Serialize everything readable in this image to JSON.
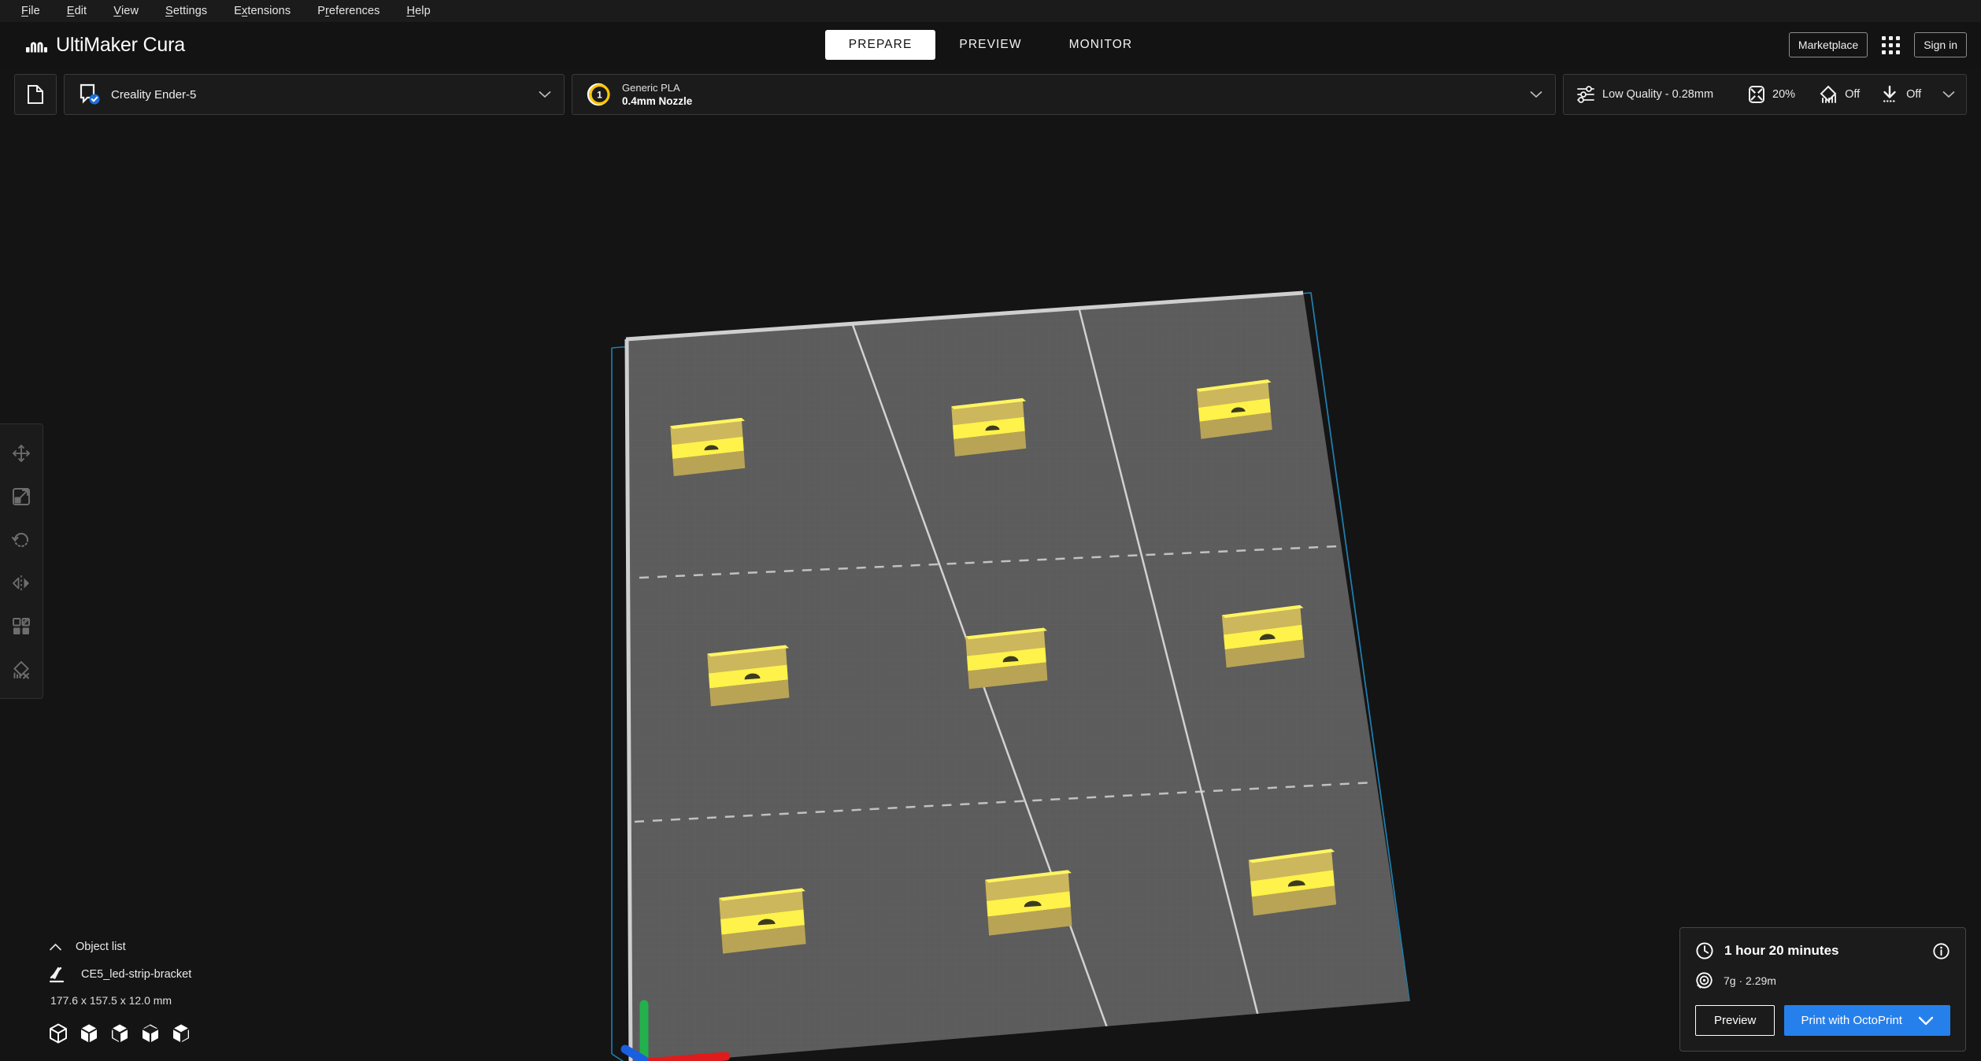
{
  "menubar": {
    "items": [
      {
        "pre": "",
        "key": "F",
        "post": "ile"
      },
      {
        "pre": "",
        "key": "E",
        "post": "dit"
      },
      {
        "pre": "",
        "key": "V",
        "post": "iew"
      },
      {
        "pre": "",
        "key": "S",
        "post": "ettings"
      },
      {
        "pre": "E",
        "key": "x",
        "post": "tensions"
      },
      {
        "pre": "P",
        "key": "r",
        "post": "eferences"
      },
      {
        "pre": "",
        "key": "H",
        "post": "elp"
      }
    ]
  },
  "app": {
    "title": "UltiMaker Cura",
    "logo_icon": "ultimaker-logo-icon"
  },
  "stages": {
    "tabs": [
      {
        "label": "PREPARE",
        "active": true
      },
      {
        "label": "PREVIEW",
        "active": false
      },
      {
        "label": "MONITOR",
        "active": false
      }
    ]
  },
  "header_right": {
    "marketplace_label": "Marketplace",
    "apps_icon": "grid-apps-icon",
    "signin_label": "Sign in"
  },
  "configbar": {
    "open_file_icon": "open-folder-icon",
    "printer": {
      "icon": "printer-connected-icon",
      "name": "Creality Ender-5",
      "chevron_icon": "chevron-down-icon"
    },
    "material": {
      "extruder_number": "1",
      "extruder_color": "#ffc700",
      "name": "Generic PLA",
      "nozzle": "0.4mm Nozzle",
      "chevron_icon": "chevron-down-icon"
    },
    "print_settings": {
      "profile_icon": "sliders-icon",
      "profile": "Low Quality - 0.28mm",
      "infill_icon": "infill-icon",
      "infill": "20%",
      "support_icon": "support-icon",
      "support": "Off",
      "adhesion_icon": "adhesion-icon",
      "adhesion": "Off",
      "chevron_icon": "chevron-down-icon"
    }
  },
  "tools": [
    {
      "name": "move-tool",
      "icon": "move-icon"
    },
    {
      "name": "scale-tool",
      "icon": "scale-icon"
    },
    {
      "name": "rotate-tool",
      "icon": "rotate-icon"
    },
    {
      "name": "mirror-tool",
      "icon": "mirror-icon"
    },
    {
      "name": "per-model-settings-tool",
      "icon": "per-model-settings-icon"
    },
    {
      "name": "support-blocker-tool",
      "icon": "support-blocker-icon"
    }
  ],
  "object_list": {
    "collapse_icon": "chevron-up-icon",
    "title": "Object list",
    "item_icon": "mesh-type-icon",
    "item_name": "CE5_led-strip-bracket",
    "dimensions": "177.6 x 157.5 x 12.0 mm",
    "view_buttons": [
      {
        "name": "view-3d",
        "icon": "cube-iso-icon"
      },
      {
        "name": "view-front",
        "icon": "cube-front-icon"
      },
      {
        "name": "view-top",
        "icon": "cube-top-icon"
      },
      {
        "name": "view-left",
        "icon": "cube-left-icon"
      },
      {
        "name": "view-right",
        "icon": "cube-right-icon"
      }
    ]
  },
  "print_info": {
    "time_icon": "clock-icon",
    "time": "1 hour 20 minutes",
    "info_icon": "info-circle-icon",
    "material_icon": "spool-icon",
    "material": "7g · 2.29m",
    "preview_label": "Preview",
    "print_label": "Print with OctoPrint",
    "print_chevron_icon": "chevron-down-icon",
    "accent_color": "#2680eb"
  },
  "viewport": {
    "background_color": "#141414",
    "buildplate_color": "#5c5c5c",
    "buildvolume_outline_color": "#1f7fae",
    "model_color": "#f3e24a",
    "axes": {
      "x": "#e01b1b",
      "y": "#1a5fe0",
      "z": "#22b14c"
    },
    "model_count": 9
  }
}
